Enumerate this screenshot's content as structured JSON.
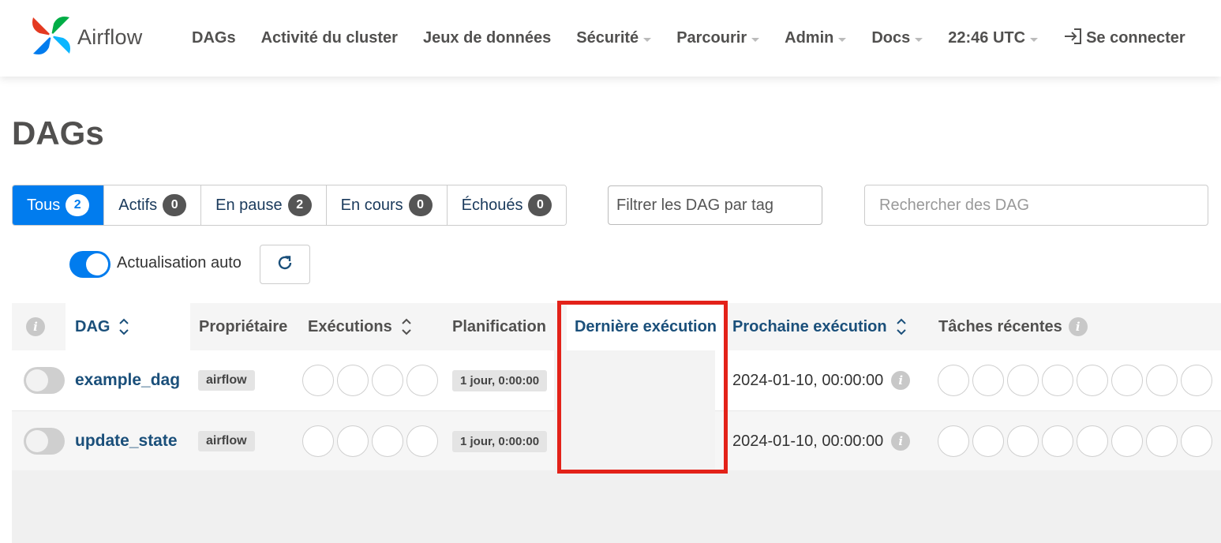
{
  "navbar": {
    "brand": "Airflow",
    "items": [
      {
        "label": "DAGs",
        "dropdown": false
      },
      {
        "label": "Activité du cluster",
        "dropdown": false
      },
      {
        "label": "Jeux de données",
        "dropdown": false
      },
      {
        "label": "Sécurité",
        "dropdown": true
      },
      {
        "label": "Parcourir",
        "dropdown": true
      },
      {
        "label": "Admin",
        "dropdown": true
      },
      {
        "label": "Docs",
        "dropdown": true
      },
      {
        "label": "22:46 UTC",
        "dropdown": true
      }
    ],
    "login": "Se connecter"
  },
  "page": {
    "title": "DAGs"
  },
  "filters": {
    "tabs": [
      {
        "label": "Tous",
        "count": "2",
        "active": true
      },
      {
        "label": "Actifs",
        "count": "0",
        "active": false
      },
      {
        "label": "En pause",
        "count": "2",
        "active": false
      },
      {
        "label": "En cours",
        "count": "0",
        "active": false
      },
      {
        "label": "Échoués",
        "count": "0",
        "active": false
      }
    ],
    "tag_placeholder": "Filtrer les DAG par tag",
    "search_placeholder": "Rechercher des DAG"
  },
  "auto_refresh": {
    "label": "Actualisation auto",
    "enabled": true
  },
  "table": {
    "headers": {
      "dag": "DAG",
      "owner": "Propriétaire",
      "runs": "Exécutions",
      "schedule": "Planification",
      "last_run": "Dernière exécution",
      "next_run": "Prochaine exécution",
      "recent_tasks": "Tâches récentes"
    },
    "rows": [
      {
        "dag_id": "example_dag",
        "owner": "airflow",
        "schedule": "1 jour, 0:00:00",
        "last_run": "",
        "next_run": "2024-01-10, 00:00:00",
        "paused": true
      },
      {
        "dag_id": "update_state",
        "owner": "airflow",
        "schedule": "1 jour, 0:00:00",
        "last_run": "",
        "next_run": "2024-01-10, 00:00:00",
        "paused": true
      }
    ]
  },
  "colors": {
    "accent": "#017cee",
    "highlight": "#e32219",
    "link": "#1a4f7a"
  }
}
